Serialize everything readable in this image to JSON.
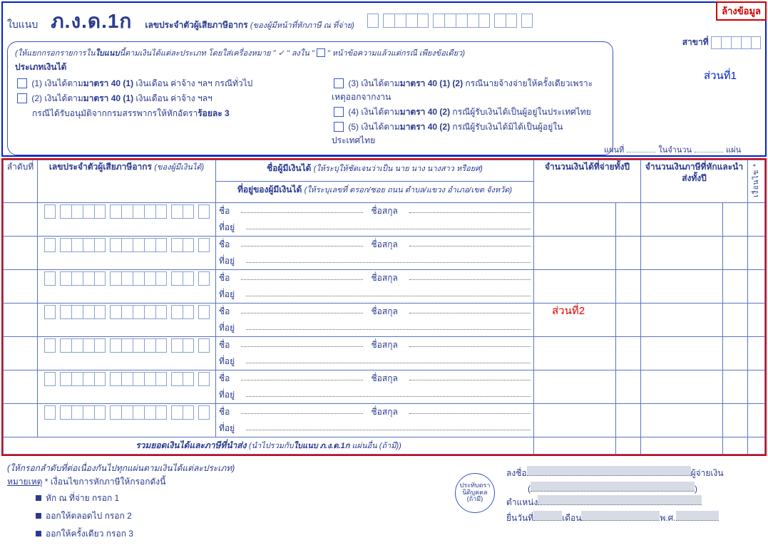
{
  "header": {
    "clear_button": "ล้างข้อมูล",
    "form_label": "ใบแนบ",
    "form_code": "ภ.ง.ด.1ก",
    "payer_tin_label": "เลขประจำตัวผู้เสียภาษีอากร",
    "payer_tin_hint": "(ของผู้มีหน้าที่หักภาษี ณ ที่จ่าย)",
    "branch_label": "สาขาที่",
    "section1_label": "ส่วนที่1",
    "sheet_no_label": "แผ่นที่",
    "sheet_total_label": "ในจำนวน",
    "sheet_unit": "แผ่น"
  },
  "instruction": {
    "main_prefix": "(ให้แยกกรอกรายการใน",
    "main_b": "ใบแนบ",
    "main_mid": "นี้ตามเงินได้แต่ละประเภท โดยใส่เครื่องหมาย \" ✓ \" ลงใน \"",
    "main_box": "",
    "main_suffix": "\" หน้าข้อความแล้วแต่กรณี เพียงข้อเดียว)",
    "income_type_label": "ประเภทเงินได้",
    "opt1": "(1) เงินได้ตาม",
    "opt1b": "มาตรา 40 (1)",
    "opt1c": " เงินเดือน ค่าจ้าง ฯลฯ กรณีทั่วไป",
    "opt2": "(2) เงินได้ตาม",
    "opt2b": "มาตรา 40 (1)",
    "opt2c": " เงินเดือน ค่าจ้าง ฯลฯ",
    "opt2d": "กรณีได้รับอนุมัติจากกรมสรรพากรให้หักอัตรา",
    "opt2e": "ร้อยละ 3",
    "opt3": "(3) เงินได้ตาม",
    "opt3b": "มาตรา 40 (1) (2)",
    "opt3c": " กรณีนายจ้างจ่ายให้ครั้งเดียวเพราะเหตุออกจากงาน",
    "opt4": "(4) เงินได้ตาม",
    "opt4b": "มาตรา 40 (2)",
    "opt4c": " กรณีผู้รับเงินได้เป็นผู้อยู่ในประเทศไทย",
    "opt5": "(5) เงินได้ตาม",
    "opt5b": "มาตรา 40 (2)",
    "opt5c": " กรณีผู้รับเงินได้มิได้เป็นผู้อยู่ในประเทศไทย"
  },
  "table": {
    "col_seq": "ลำดับที่",
    "col_tin": "เลขประจำตัวผู้เสียภาษีอากร",
    "col_tin_hint": "(ของผู้มีเงินได้)",
    "col_name_top": "ชื่อผู้มีเงินได้",
    "col_name_top_hint": "(ให้ระบุให้ชัดเจนว่าเป็น นาย นาง นางสาว หรือยศ)",
    "col_name_bot": "ที่อยู่ของผู้มีเงินได้",
    "col_name_bot_hint": "(ให้ระบุเลขที่ ตรอก/ซอย ถนน ตำบล/แขวง อำเภอ/เขต จังหวัด)",
    "col_income": "จำนวนเงินได้ที่จ่ายทั้งปี",
    "col_tax": "จำนวนเงินภาษีที่หักและนำส่งทั้งปี",
    "col_cond": "เงื่อนไข *",
    "row_name_label": "ชื่อ",
    "row_surname_label": "ชื่อสกุล",
    "row_addr_label": "ที่อยู่",
    "section2_label": "ส่วนที่2",
    "total_prefix": "รวมยอดเงินได้และภาษีที่นำส่ง",
    "total_hint1": "(นำไปรวมกับ",
    "total_b": "ใบแนบ ภ.ง.ด.1ก",
    "total_hint2": "แผ่นอื่น (ถ้ามี))"
  },
  "footer": {
    "seq_note": "(ให้กรอกลำดับที่ต่อเนื่องกันไปทุกแผ่นตามเงินได้แต่ละประเภท)",
    "note_label": "หมายเหตุ",
    "note_intro": " * เงื่อนไขการหักภาษีให้กรอกดังนี้",
    "bul1": "หัก ณ ที่จ่าย กรอก 1",
    "bul2": "ออกให้ตลอดไป กรอก 2",
    "bul3": "ออกให้ครั้งเดียว กรอก 3",
    "stamp_l1": "ประทับตรา",
    "stamp_l2": "นิติบุคคล",
    "stamp_l3": "(ถ้ามี)",
    "sig_label": "ลงชื่อ",
    "sig_role": "ผู้จ่ายเงิน",
    "pos_label": "ตำแหน่ง",
    "date_label": "ยื่นวันที่",
    "month_label": "เดือน",
    "year_label": "พ.ศ."
  }
}
